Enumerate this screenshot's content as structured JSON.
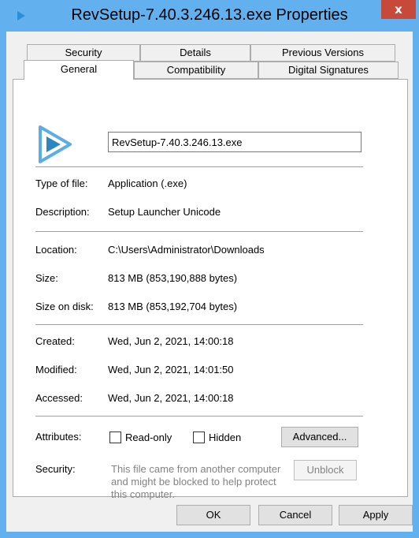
{
  "window": {
    "title": "RevSetup-7.40.3.246.13.exe Properties",
    "close_label": "x"
  },
  "tabs": {
    "row1": [
      "Security",
      "Details",
      "Previous Versions"
    ],
    "row2": [
      "General",
      "Compatibility",
      "Digital Signatures"
    ]
  },
  "general": {
    "file_name": "RevSetup-7.40.3.246.13.exe",
    "type_label": "Type of file:",
    "type_value": "Application (.exe)",
    "desc_label": "Description:",
    "desc_value": "Setup Launcher Unicode",
    "location_label": "Location:",
    "location_value": "C:\\Users\\Administrator\\Downloads",
    "size_label": "Size:",
    "size_value": "813 MB (853,190,888 bytes)",
    "sizeondisk_label": "Size on disk:",
    "sizeondisk_value": "813 MB (853,192,704 bytes)",
    "created_label": "Created:",
    "created_value": "Wed, Jun 2, 2021, 14:00:18",
    "modified_label": "Modified:",
    "modified_value": "Wed, Jun 2, 2021, 14:01:50",
    "accessed_label": "Accessed:",
    "accessed_value": "Wed, Jun 2, 2021, 14:00:18",
    "attributes_label": "Attributes:",
    "readonly_label": "Read-only",
    "hidden_label": "Hidden",
    "advanced_label": "Advanced...",
    "security_label": "Security:",
    "security_text": "This file came from another computer and might be blocked to help protect this computer.",
    "unblock_label": "Unblock"
  },
  "footer": {
    "ok": "OK",
    "cancel": "Cancel",
    "apply": "Apply"
  },
  "icons": {
    "app": "play-arrow-icon",
    "close": "close-icon"
  }
}
